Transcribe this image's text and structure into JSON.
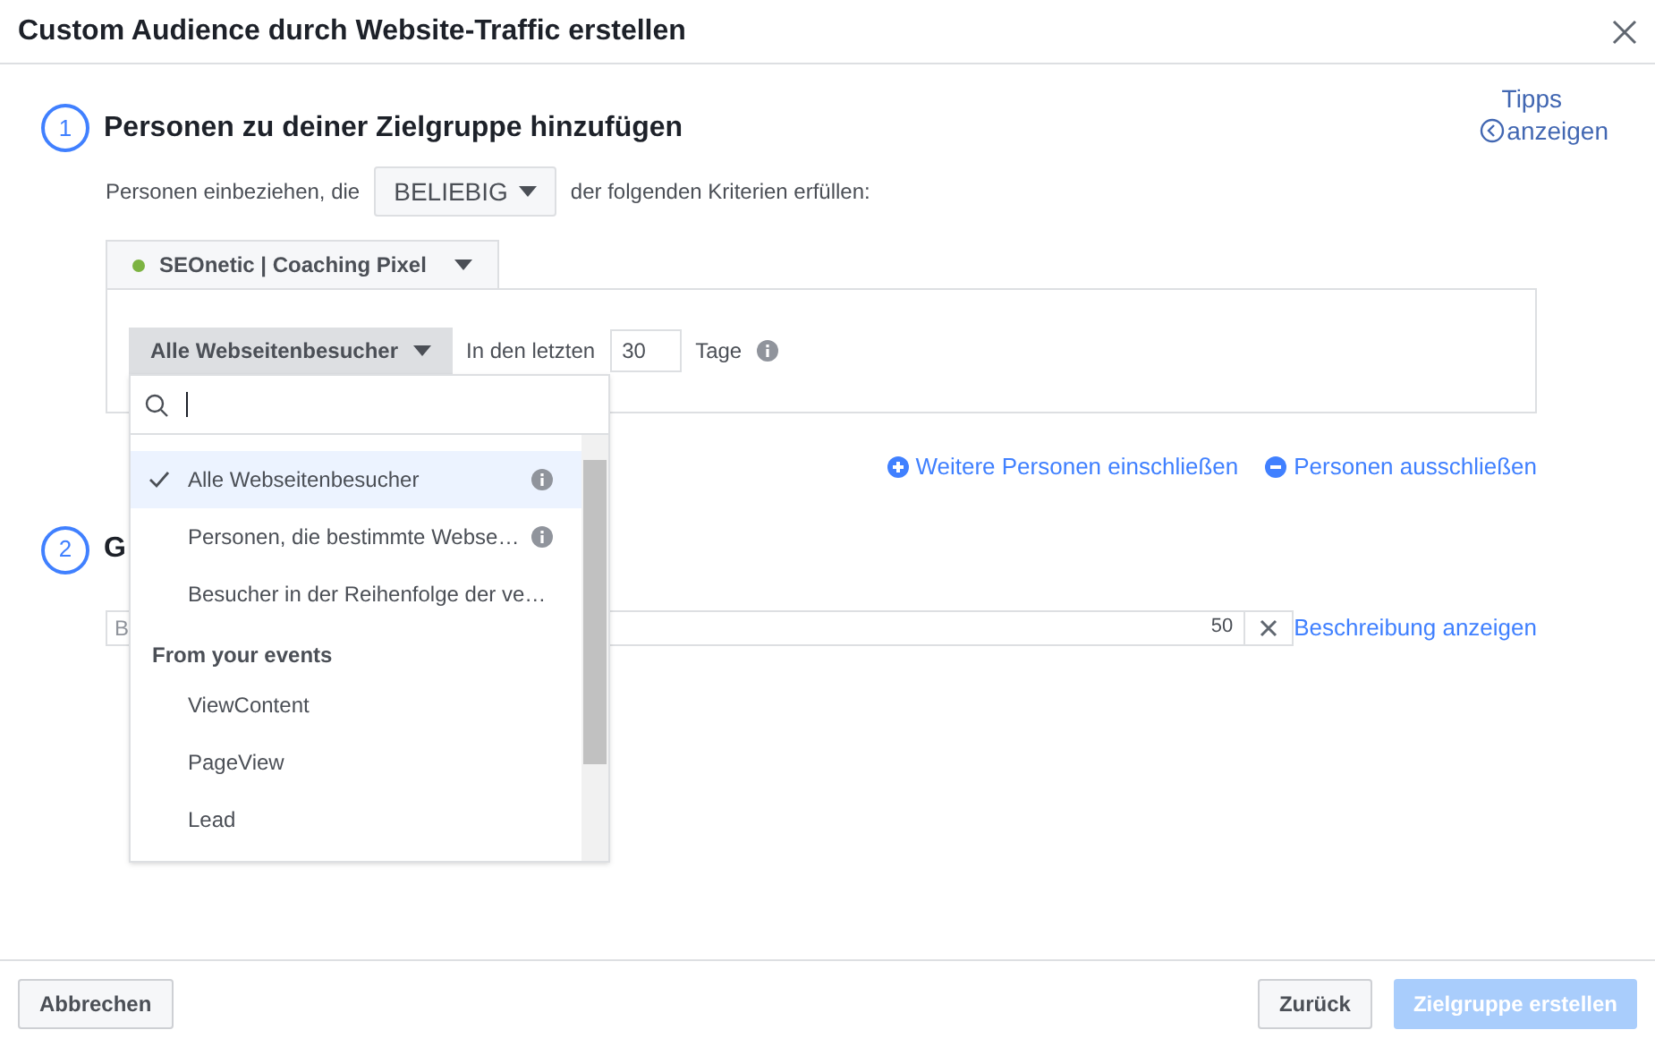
{
  "dialog": {
    "title": "Custom Audience durch Website-Traffic erstellen"
  },
  "tips": {
    "line_1": "Tipps",
    "line_2": "anzeigen"
  },
  "step_1": {
    "number": "1",
    "title": "Personen zu deiner Zielgruppe hinzufügen",
    "include_prefix": "Personen einbeziehen, die",
    "match_select": "BELIEBIG",
    "include_suffix": "der folgenden Kriterien erfüllen:",
    "pixel": "SEOnetic | Coaching Pixel",
    "audience_select": "Alle Webseitenbesucher",
    "days_prefix": "In den letzten",
    "days": "30",
    "days_suffix": "Tage"
  },
  "links": [
    {
      "kind": "plus",
      "label": "Weitere Personen einschließen"
    },
    {
      "kind": "minus",
      "label": "Personen ausschließen"
    }
  ],
  "dropdown": {
    "items": [
      {
        "kind": "option",
        "label": "Alle Webseitenbesucher",
        "selected": true,
        "info": true
      },
      {
        "kind": "option",
        "label": "Personen, die bestimmte Webse…",
        "selected": false,
        "info": true
      },
      {
        "kind": "option",
        "label": "Besucher in der Reihenfolge der ve…",
        "selected": false,
        "info": false
      },
      {
        "kind": "header",
        "label": "From your events"
      },
      {
        "kind": "option",
        "label": "ViewContent",
        "selected": false,
        "info": false
      },
      {
        "kind": "option",
        "label": "PageView",
        "selected": false,
        "info": false
      },
      {
        "kind": "option",
        "label": "Lead",
        "selected": false,
        "info": false
      }
    ]
  },
  "step_2": {
    "number": "2",
    "title": "G",
    "name_field": {
      "placeholder": "B",
      "counter": "50"
    },
    "description_link": "Beschreibung anzeigen"
  },
  "footer": {
    "cancel": "Abbrechen",
    "back": "Zurück",
    "create": {
      "label": "Zielgruppe erstellen",
      "disabled": true
    }
  }
}
